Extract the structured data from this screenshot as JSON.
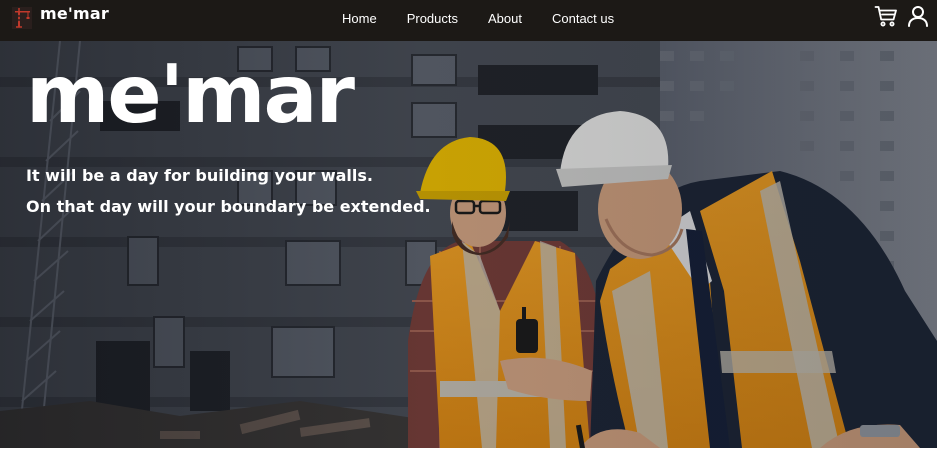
{
  "header": {
    "brand_name": "me'mar",
    "nav": [
      {
        "label": "Home"
      },
      {
        "label": "Products"
      },
      {
        "label": "About"
      },
      {
        "label": "Contact us"
      }
    ],
    "icons": [
      "cart-icon",
      "user-icon"
    ]
  },
  "hero": {
    "title": "me'mar",
    "tagline_line1": "It will be a day for building your walls.",
    "tagline_line2": "On that day will your boundary be extended.",
    "image_subject": "two construction workers in hard hats and safety vests reviewing plans in front of a building under construction"
  },
  "colors": {
    "nav_background": "#1c1916",
    "text": "#ffffff",
    "logo_red": "#c0392b",
    "vest_orange": "#f39c1f",
    "helmet_yellow": "#f2c200"
  }
}
